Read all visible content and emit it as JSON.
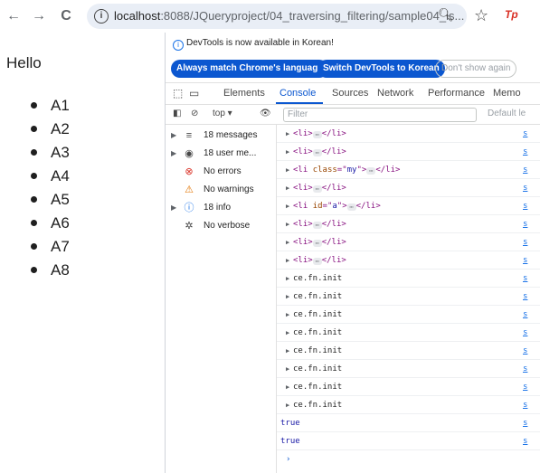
{
  "browser": {
    "url_host": "localhost",
    "url_rest": ":8088/JQueryproject/04_traversing_filtering/sample04_is..."
  },
  "page": {
    "heading": "Hello",
    "items": [
      "A1",
      "A2",
      "A3",
      "A4",
      "A5",
      "A6",
      "A7",
      "A8"
    ]
  },
  "devtools": {
    "banner": {
      "message": "DevTools is now available in Korean!",
      "btn_match": "Always match Chrome's language",
      "btn_switch": "Switch DevTools to Korean",
      "btn_dont_show": "Don't show again"
    },
    "tabs": [
      "Elements",
      "Console",
      "Sources",
      "Network",
      "Performance",
      "Memo"
    ],
    "filterbar": {
      "context": "top",
      "filter_placeholder": "Filter",
      "levels": "Default le"
    },
    "sidebar": [
      {
        "label": "18 messages",
        "icon": "≡",
        "color": "#474747",
        "arrow": "▶"
      },
      {
        "label": "18 user me...",
        "icon": "◉",
        "color": "#474747",
        "arrow": "▶"
      },
      {
        "label": "No errors",
        "icon": "⊗",
        "color": "#d93025",
        "arrow": ""
      },
      {
        "label": "No warnings",
        "icon": "⚠",
        "color": "#e37400",
        "arrow": ""
      },
      {
        "label": "18 info",
        "icon": "ⓘ",
        "color": "#1a73e8",
        "arrow": "▶"
      },
      {
        "label": "No verbose",
        "icon": "✲",
        "color": "#474747",
        "arrow": ""
      }
    ],
    "console": {
      "li_rows": [
        {
          "attr": "",
          "val": ""
        },
        {
          "attr": "",
          "val": ""
        },
        {
          "attr": "class",
          "val": "my"
        },
        {
          "attr": "",
          "val": ""
        },
        {
          "attr": "id",
          "val": "a"
        },
        {
          "attr": "",
          "val": ""
        },
        {
          "attr": "",
          "val": ""
        },
        {
          "attr": "",
          "val": ""
        }
      ],
      "obj_label": "ce.fn.init",
      "obj_count": 8,
      "bool_rows": [
        "true",
        "true"
      ],
      "source_label": "s"
    }
  }
}
